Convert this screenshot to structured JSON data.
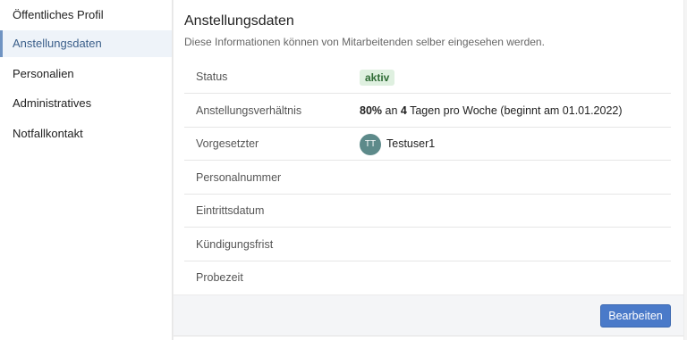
{
  "sidebar": {
    "items": [
      {
        "label": "Öffentliches Profil"
      },
      {
        "label": "Anstellungsdaten"
      },
      {
        "label": "Personalien"
      },
      {
        "label": "Administratives"
      },
      {
        "label": "Notfallkontakt"
      }
    ],
    "active_index": 1
  },
  "main": {
    "title": "Anstellungsdaten",
    "subtitle": "Diese Informationen können von Mitarbeitenden selber eingesehen werden.",
    "rows": {
      "status": {
        "label": "Status",
        "value": "aktiv"
      },
      "employment": {
        "label": "Anstellungsverhältnis",
        "percent": "80%",
        "text1": " an ",
        "days": "4",
        "text2": " Tagen pro Woche (beginnt am 01.01.2022)"
      },
      "supervisor": {
        "label": "Vorgesetzter",
        "initials": "TT",
        "name": "Testuser1"
      },
      "personnel_number": {
        "label": "Personalnummer",
        "value": ""
      },
      "entry_date": {
        "label": "Eintrittsdatum",
        "value": ""
      },
      "notice_period": {
        "label": "Kündigungsfrist",
        "value": ""
      },
      "probation": {
        "label": "Probezeit",
        "value": ""
      }
    }
  },
  "footer": {
    "edit_label": "Bearbeiten"
  },
  "colors": {
    "accent": "#4a7ac9",
    "active_nav_bg": "#eef3f9",
    "active_nav_text": "#3b5f8a",
    "badge_bg": "#dff0e0",
    "badge_text": "#2f6b35",
    "avatar_bg": "#5d8a8a"
  }
}
